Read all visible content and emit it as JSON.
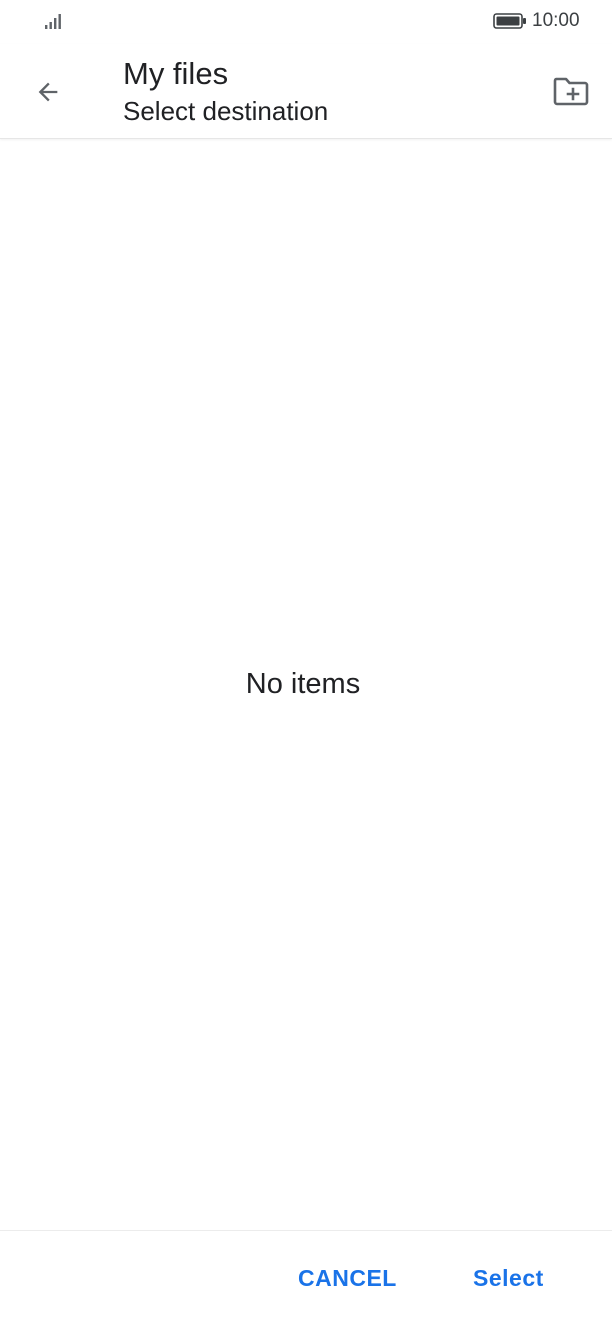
{
  "status_bar": {
    "time": "10:00",
    "signal_icon": "signal-icon",
    "battery_icon": "battery-icon"
  },
  "app_bar": {
    "back_icon": "arrow-back-icon",
    "title": "My files",
    "subtitle": "Select destination",
    "new_folder_icon": "create-new-folder-icon"
  },
  "content": {
    "empty_message": "No items"
  },
  "actions": {
    "cancel_label": "CANCEL",
    "select_label": "Select"
  },
  "colors": {
    "accent": "#1a73e8",
    "text_primary": "#202124",
    "icon_gray": "#5f6368",
    "background": "#ffffff"
  }
}
